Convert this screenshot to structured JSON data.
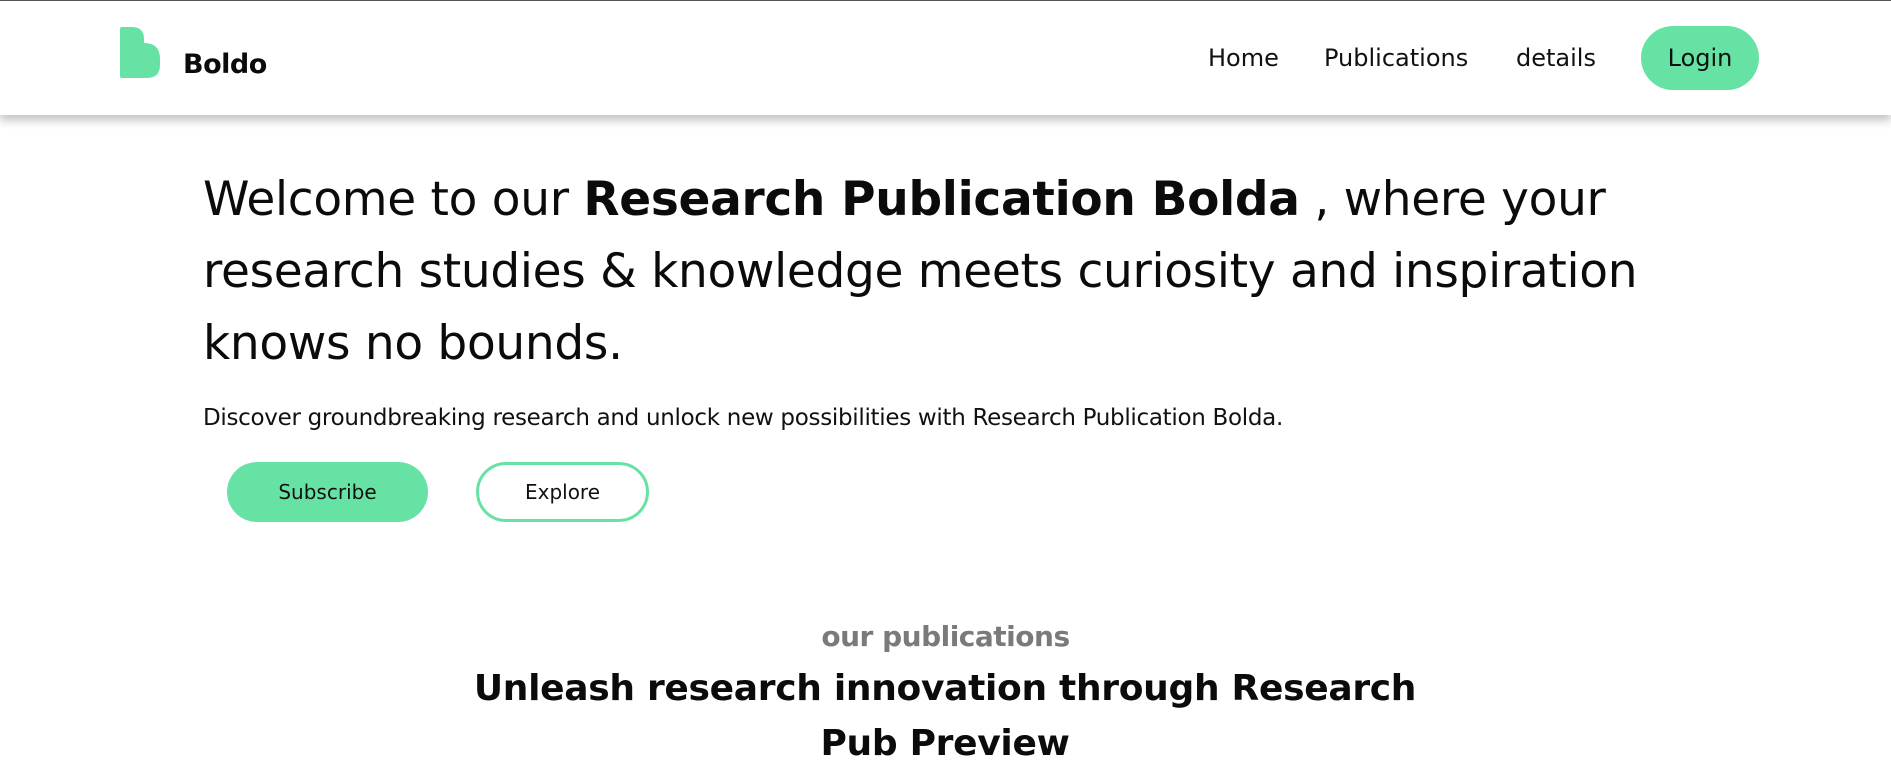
{
  "header": {
    "brand": "Boldo",
    "logo_icon": "boldo-b-logo-icon",
    "nav": {
      "home": "Home",
      "publications": "Publications",
      "details": "details"
    },
    "login_label": "Login"
  },
  "hero": {
    "title_part1": "Welcome to our ",
    "title_bold": "Research Publication Bolda",
    "title_part2": " , where your research studies & knowledge meets curiosity and inspiration knows no bounds.",
    "subtitle": "Discover groundbreaking research and unlock new possibilities with Research Publication Bolda.",
    "subscribe_label": "Subscribe",
    "explore_label": "Explore"
  },
  "publications": {
    "eyebrow": "our publications",
    "heading": "Unleash research innovation through Research Pub Preview"
  },
  "colors": {
    "accent": "#66e3a4",
    "text": "#0b0b0b",
    "muted": "#7a7a7a"
  }
}
